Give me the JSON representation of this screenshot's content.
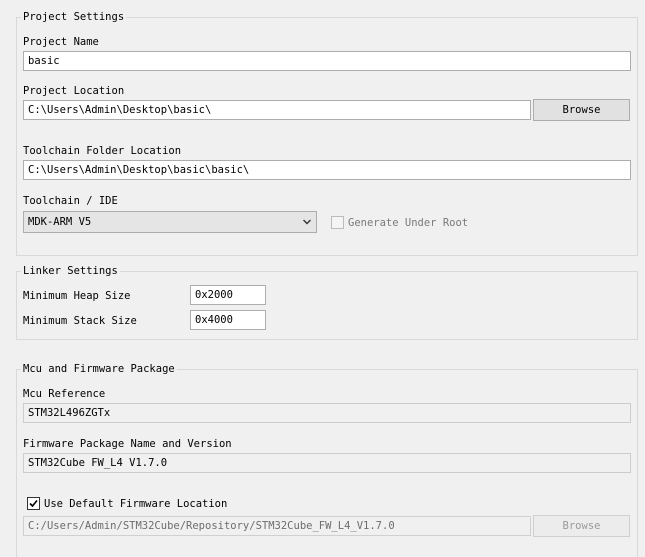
{
  "project_settings": {
    "title": "Project Settings",
    "project_name_label": "Project Name",
    "project_name_value": "basic",
    "project_location_label": "Project Location",
    "project_location_value": "C:\\Users\\Admin\\Desktop\\basic\\",
    "browse_label": "Browse",
    "toolchain_folder_label": "Toolchain Folder Location",
    "toolchain_folder_value": "C:\\Users\\Admin\\Desktop\\basic\\basic\\",
    "toolchain_ide_label": "Toolchain / IDE",
    "toolchain_ide_value": "MDK-ARM V5",
    "generate_under_root_label": "Generate Under Root",
    "generate_under_root_checked": false
  },
  "linker_settings": {
    "title": "Linker Settings",
    "min_heap_label": "Minimum Heap Size",
    "min_heap_value": "0x2000",
    "min_stack_label": "Minimum Stack Size",
    "min_stack_value": "0x4000"
  },
  "mcu_firmware": {
    "title": "Mcu and Firmware Package",
    "mcu_reference_label": "Mcu Reference",
    "mcu_reference_value": "STM32L496ZGTx",
    "firmware_package_label": "Firmware Package Name and Version",
    "firmware_package_value": "STM32Cube FW_L4 V1.7.0",
    "use_default_location_label": "Use Default Firmware Location",
    "use_default_location_checked": true,
    "firmware_location_value": "C:/Users/Admin/STM32Cube/Repository/STM32Cube_FW_L4_V1.7.0",
    "browse_label": "Browse"
  }
}
